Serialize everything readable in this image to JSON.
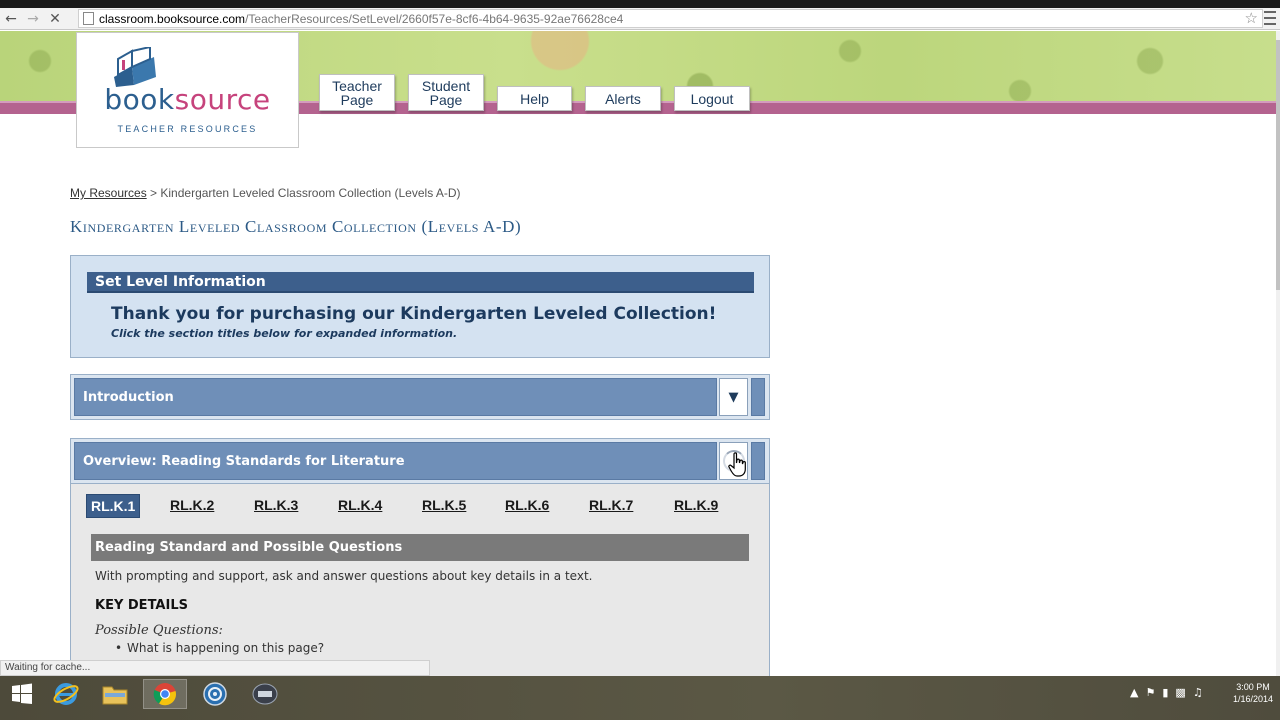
{
  "browser": {
    "url_host": "classroom.booksource.com",
    "url_path": "/TeacherResources/SetLevel/2660f57e-8cf6-4b64-9635-92ae76628ce4",
    "status_text": "Waiting for cache..."
  },
  "site": {
    "logo_word_1": "book",
    "logo_word_2": "source",
    "logo_tagline": "TEACHER RESOURCES",
    "nav": [
      {
        "line1": "Teacher",
        "line2": "Page"
      },
      {
        "line1": "Student",
        "line2": "Page"
      },
      {
        "label": "Help"
      },
      {
        "label": "Alerts"
      },
      {
        "label": "Logout"
      }
    ]
  },
  "breadcrumb": {
    "link": "My Resources",
    "separator": ">",
    "current": "Kindergarten Leveled Classroom Collection (Levels A-D)"
  },
  "page_title": "Kindergarten Leveled Classroom Collection (Levels A-D)",
  "set_level": {
    "heading": "Set Level Information",
    "thanks": "Thank you for purchasing our Kindergarten Leveled Collection!",
    "instructions": "Click the section titles below for expanded information."
  },
  "sections": {
    "introduction": {
      "title": "Introduction",
      "toggle": "▼"
    },
    "overview": {
      "title": "Overview: Reading Standards for Literature"
    }
  },
  "standards_tabs": [
    "RL.K.1",
    "RL.K.2",
    "RL.K.3",
    "RL.K.4",
    "RL.K.5",
    "RL.K.6",
    "RL.K.7",
    "RL.K.9"
  ],
  "standard_detail": {
    "heading": "Reading Standard and Possible Questions",
    "text": "With prompting and support, ask and answer questions about key details in a text.",
    "key_details": "KEY DETAILS",
    "possible_questions": "Possible Questions:",
    "questions": [
      "What is happening on this page?"
    ]
  },
  "taskbar": {
    "time": "3:00 PM",
    "date": "1/16/2014"
  },
  "colors": {
    "brand_blue": "#2c5f8f",
    "brand_pink": "#c6437c",
    "header_blue": "#3d5f8c",
    "section_blue": "#6f8fb8"
  }
}
